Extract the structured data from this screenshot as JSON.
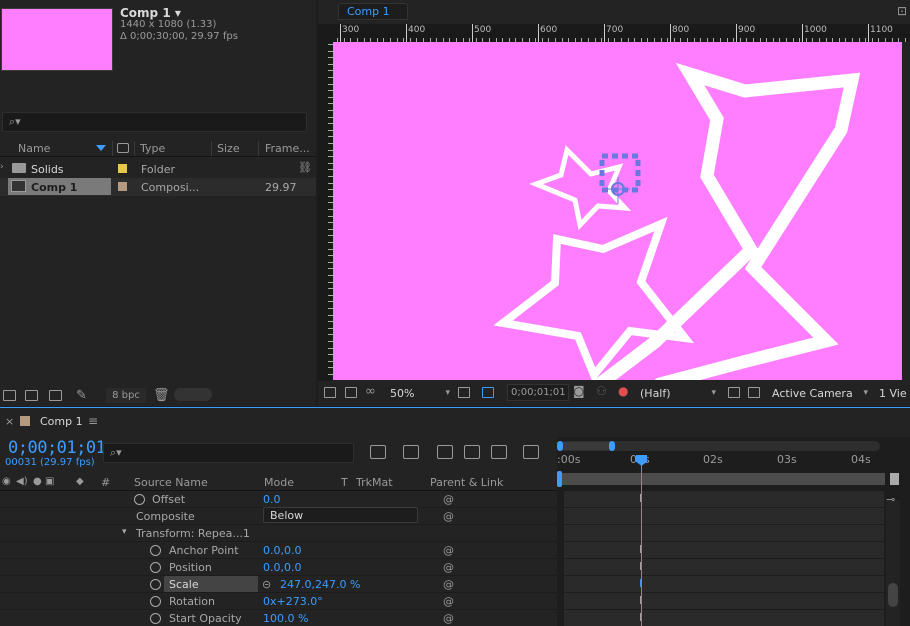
{
  "project": {
    "comp_name": "Comp 1 ▾",
    "comp_resolution": "1440 x 1080 (1.33)",
    "comp_duration": "Δ 0;00;30;00, 29.97 fps",
    "search_placeholder": "⌕▾",
    "columns": [
      "Name",
      "Type",
      "Size",
      "Frame..."
    ],
    "items": [
      {
        "name": "Solids",
        "type": "Folder",
        "size": "",
        "frame": "",
        "label_color": "#e6c84a"
      },
      {
        "name": "Comp 1",
        "type": "Composi...",
        "size": "",
        "frame": "29.97",
        "label_color": "#b39a80"
      }
    ],
    "bpc": "8 bpc"
  },
  "viewer": {
    "tab": "Comp 1",
    "ruler_labels": [
      "300",
      "400",
      "500",
      "600",
      "700",
      "800",
      "900",
      "1000",
      "1100"
    ],
    "zoom": "50%",
    "timecode": "0;00;01;01",
    "resolution": "(Half)",
    "camera": "Active Camera",
    "views": "1 Vie",
    "canvas_color": "#ff7dff"
  },
  "timeline": {
    "tab": "Comp 1",
    "close": "×",
    "menu": "≡",
    "timecode": "0;00;01;01",
    "frames": "00031 (29.97 fps)",
    "search_placeholder": "⌕▾",
    "columns": {
      "source_name": "Source Name",
      "mode": "Mode",
      "t": "T",
      "trkmat": "TrkMat",
      "parent": "Parent & Link",
      "num": "#"
    },
    "rows": [
      {
        "name": "Offset",
        "value": "0.0",
        "stopwatch": true,
        "indent": 1
      },
      {
        "name": "Composite",
        "value": "Below",
        "stopwatch": false,
        "indent": 0,
        "dropdown": true
      },
      {
        "name": "Transform: Repea...1",
        "value": "",
        "stopwatch": false,
        "indent": 0,
        "twirl": "▾"
      },
      {
        "name": "Anchor Point",
        "value": "0.0,0.0",
        "stopwatch": true,
        "indent": 2
      },
      {
        "name": "Position",
        "value": "0.0,0.0",
        "stopwatch": true,
        "indent": 2
      },
      {
        "name": "Scale",
        "value": "247.0,247.0 %",
        "stopwatch": true,
        "indent": 2,
        "selected": true
      },
      {
        "name": "Rotation",
        "value": "0x+273.0°",
        "stopwatch": true,
        "indent": 2
      },
      {
        "name": "Start Opacity",
        "value": "100.0 %",
        "stopwatch": true,
        "indent": 2
      }
    ],
    "time_labels": [
      ":00s",
      "01s",
      "02s",
      "03s",
      "04s"
    ],
    "accent": "#3d9cff"
  }
}
